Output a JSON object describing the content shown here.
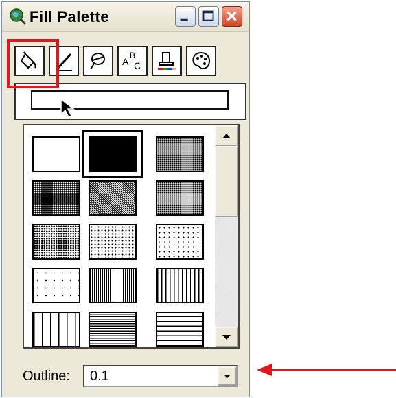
{
  "window": {
    "title": "Fill Palette",
    "buttons": [
      "minimize",
      "maximize",
      "close"
    ]
  },
  "tabs": [
    {
      "name": "fill",
      "icon": "paint-bucket-icon",
      "selected": true
    },
    {
      "name": "line",
      "icon": "pen-icon",
      "selected": false
    },
    {
      "name": "marker",
      "icon": "marker-symbol-icon",
      "selected": false
    },
    {
      "name": "text",
      "icon": "text-symbol-icon",
      "selected": false
    },
    {
      "name": "color",
      "icon": "color-fill-icon",
      "selected": false
    },
    {
      "name": "palette",
      "icon": "palette-icon",
      "selected": false
    }
  ],
  "patterns": [
    "white",
    "solid-black",
    "dense-dots",
    "dark-stipple",
    "fine-crosshatch",
    "medium-dots",
    "light-stipple",
    "sparse-dots",
    "very-sparse-dots",
    "scattered-dots",
    "fine-vertical-lines",
    "vertical-lines",
    "wide-vertical-lines",
    "fine-horizontal-lines",
    "horizontal-lines"
  ],
  "selected_pattern": "solid-black",
  "outline": {
    "label": "Outline:",
    "value": "0.1"
  },
  "colors": {
    "highlight": "#e0181e",
    "arrow": "#e0181e"
  }
}
